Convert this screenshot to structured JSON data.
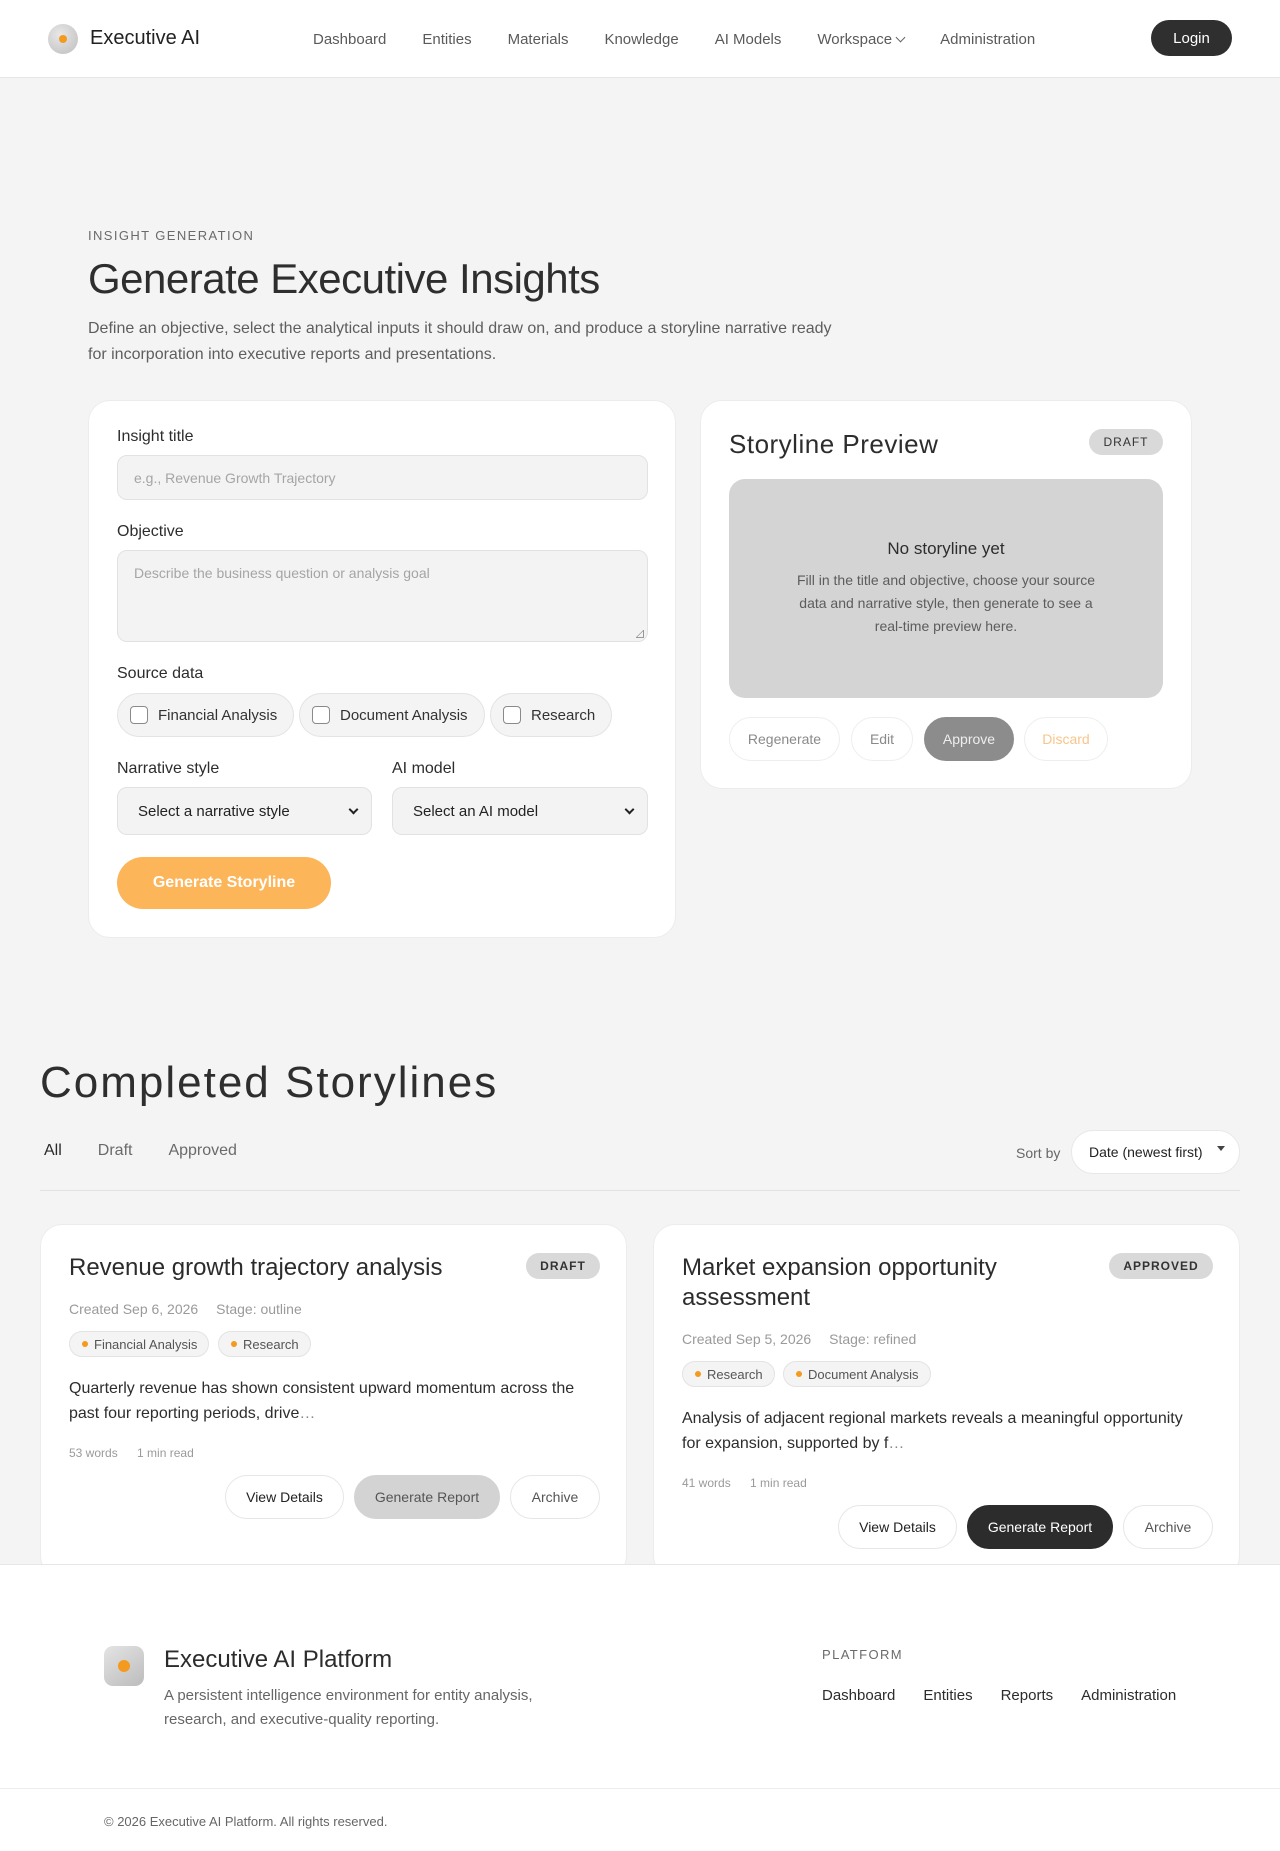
{
  "header": {
    "brand": "Executive AI",
    "nav": [
      "Dashboard",
      "Entities",
      "Materials",
      "Knowledge",
      "AI Models",
      "Workspace",
      "Administration"
    ],
    "login_label": "Login"
  },
  "hero": {
    "eyebrow": "INSIGHT GENERATION",
    "title": "Generate Executive Insights",
    "description": "Define an objective, select the analytical inputs it should draw on, and produce a storyline narrative ready for incorporation into executive reports and presentations."
  },
  "form": {
    "title_label": "Insight title",
    "title_placeholder": "e.g., Revenue Growth Trajectory",
    "objective_label": "Objective",
    "objective_placeholder": "Describe the business question or analysis goal",
    "source_label": "Source data",
    "sources": [
      "Financial Analysis",
      "Document Analysis",
      "Research"
    ],
    "narrative_label": "Narrative style",
    "narrative_value": "Select a narrative style",
    "model_label": "AI model",
    "model_value": "Select an AI model",
    "generate_label": "Generate Storyline"
  },
  "preview": {
    "title": "Storyline Preview",
    "badge": "DRAFT",
    "empty_title": "No storyline yet",
    "empty_text": "Fill in the title and objective, choose your source data and narrative style, then generate to see a real-time preview here.",
    "actions": [
      "Regenerate",
      "Edit",
      "Approve",
      "Discard"
    ]
  },
  "completed": {
    "title": "Completed Storylines",
    "tabs": [
      "All",
      "Draft",
      "Approved"
    ],
    "sort_label": "Sort by",
    "sort_value": "Date (newest first)",
    "cards": [
      {
        "title": "Revenue growth trajectory analysis",
        "badge": "DRAFT",
        "created": "Created Sep 6, 2026",
        "stage": "Stage: outline",
        "tags": [
          "Financial Analysis",
          "Research"
        ],
        "excerpt": "Quarterly revenue has shown consistent upward momentum across the past four reporting periods, drive",
        "ellipsis": "…",
        "words": "53 words",
        "read": "1 min read",
        "actions": [
          "View Details",
          "Generate Report",
          "Archive"
        ]
      },
      {
        "title": "Market expansion opportunity assessment",
        "badge": "APPROVED",
        "created": "Created Sep 5, 2026",
        "stage": "Stage: refined",
        "tags": [
          "Research",
          "Document Analysis"
        ],
        "excerpt": "Analysis of adjacent regional markets reveals a meaningful opportunity for expansion, supported by f",
        "ellipsis": "…",
        "words": "41 words",
        "read": "1 min read",
        "actions": [
          "View Details",
          "Generate Report",
          "Archive"
        ]
      }
    ]
  },
  "footer": {
    "name": "Executive AI Platform",
    "description": "A persistent intelligence environment for entity analysis, research, and executive-quality reporting.",
    "heading": "PLATFORM",
    "links": [
      "Dashboard",
      "Entities",
      "Reports",
      "Administration"
    ],
    "copyright": "© 2026 Executive AI Platform. All rights reserved."
  },
  "colors": {
    "accent": "#f39a1f",
    "generate_button": "#fdb55a",
    "dark_button": "#2c2c2c",
    "page_bg": "#f4f4f4"
  }
}
